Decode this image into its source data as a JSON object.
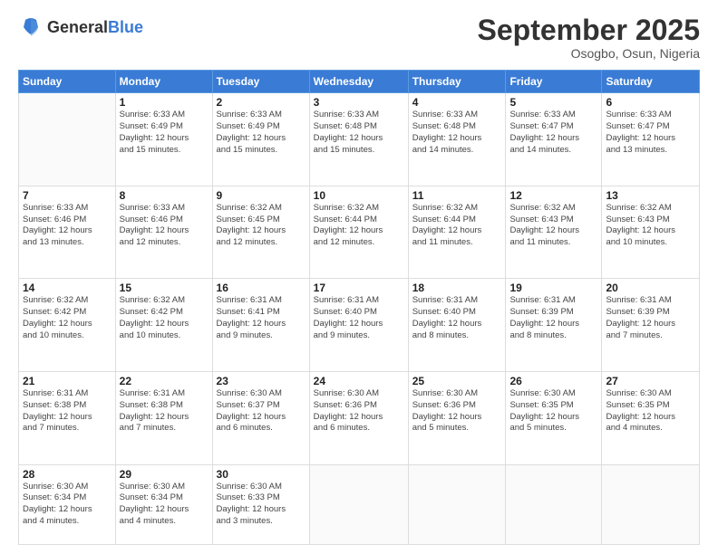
{
  "header": {
    "logo_general": "General",
    "logo_blue": "Blue",
    "month_title": "September 2025",
    "location": "Osogbo, Osun, Nigeria"
  },
  "weekdays": [
    "Sunday",
    "Monday",
    "Tuesday",
    "Wednesday",
    "Thursday",
    "Friday",
    "Saturday"
  ],
  "weeks": [
    [
      {
        "day": "",
        "info": ""
      },
      {
        "day": "1",
        "info": "Sunrise: 6:33 AM\nSunset: 6:49 PM\nDaylight: 12 hours\nand 15 minutes."
      },
      {
        "day": "2",
        "info": "Sunrise: 6:33 AM\nSunset: 6:49 PM\nDaylight: 12 hours\nand 15 minutes."
      },
      {
        "day": "3",
        "info": "Sunrise: 6:33 AM\nSunset: 6:48 PM\nDaylight: 12 hours\nand 15 minutes."
      },
      {
        "day": "4",
        "info": "Sunrise: 6:33 AM\nSunset: 6:48 PM\nDaylight: 12 hours\nand 14 minutes."
      },
      {
        "day": "5",
        "info": "Sunrise: 6:33 AM\nSunset: 6:47 PM\nDaylight: 12 hours\nand 14 minutes."
      },
      {
        "day": "6",
        "info": "Sunrise: 6:33 AM\nSunset: 6:47 PM\nDaylight: 12 hours\nand 13 minutes."
      }
    ],
    [
      {
        "day": "7",
        "info": "Sunrise: 6:33 AM\nSunset: 6:46 PM\nDaylight: 12 hours\nand 13 minutes."
      },
      {
        "day": "8",
        "info": "Sunrise: 6:33 AM\nSunset: 6:46 PM\nDaylight: 12 hours\nand 12 minutes."
      },
      {
        "day": "9",
        "info": "Sunrise: 6:32 AM\nSunset: 6:45 PM\nDaylight: 12 hours\nand 12 minutes."
      },
      {
        "day": "10",
        "info": "Sunrise: 6:32 AM\nSunset: 6:44 PM\nDaylight: 12 hours\nand 12 minutes."
      },
      {
        "day": "11",
        "info": "Sunrise: 6:32 AM\nSunset: 6:44 PM\nDaylight: 12 hours\nand 11 minutes."
      },
      {
        "day": "12",
        "info": "Sunrise: 6:32 AM\nSunset: 6:43 PM\nDaylight: 12 hours\nand 11 minutes."
      },
      {
        "day": "13",
        "info": "Sunrise: 6:32 AM\nSunset: 6:43 PM\nDaylight: 12 hours\nand 10 minutes."
      }
    ],
    [
      {
        "day": "14",
        "info": "Sunrise: 6:32 AM\nSunset: 6:42 PM\nDaylight: 12 hours\nand 10 minutes."
      },
      {
        "day": "15",
        "info": "Sunrise: 6:32 AM\nSunset: 6:42 PM\nDaylight: 12 hours\nand 10 minutes."
      },
      {
        "day": "16",
        "info": "Sunrise: 6:31 AM\nSunset: 6:41 PM\nDaylight: 12 hours\nand 9 minutes."
      },
      {
        "day": "17",
        "info": "Sunrise: 6:31 AM\nSunset: 6:40 PM\nDaylight: 12 hours\nand 9 minutes."
      },
      {
        "day": "18",
        "info": "Sunrise: 6:31 AM\nSunset: 6:40 PM\nDaylight: 12 hours\nand 8 minutes."
      },
      {
        "day": "19",
        "info": "Sunrise: 6:31 AM\nSunset: 6:39 PM\nDaylight: 12 hours\nand 8 minutes."
      },
      {
        "day": "20",
        "info": "Sunrise: 6:31 AM\nSunset: 6:39 PM\nDaylight: 12 hours\nand 7 minutes."
      }
    ],
    [
      {
        "day": "21",
        "info": "Sunrise: 6:31 AM\nSunset: 6:38 PM\nDaylight: 12 hours\nand 7 minutes."
      },
      {
        "day": "22",
        "info": "Sunrise: 6:31 AM\nSunset: 6:38 PM\nDaylight: 12 hours\nand 7 minutes."
      },
      {
        "day": "23",
        "info": "Sunrise: 6:30 AM\nSunset: 6:37 PM\nDaylight: 12 hours\nand 6 minutes."
      },
      {
        "day": "24",
        "info": "Sunrise: 6:30 AM\nSunset: 6:36 PM\nDaylight: 12 hours\nand 6 minutes."
      },
      {
        "day": "25",
        "info": "Sunrise: 6:30 AM\nSunset: 6:36 PM\nDaylight: 12 hours\nand 5 minutes."
      },
      {
        "day": "26",
        "info": "Sunrise: 6:30 AM\nSunset: 6:35 PM\nDaylight: 12 hours\nand 5 minutes."
      },
      {
        "day": "27",
        "info": "Sunrise: 6:30 AM\nSunset: 6:35 PM\nDaylight: 12 hours\nand 4 minutes."
      }
    ],
    [
      {
        "day": "28",
        "info": "Sunrise: 6:30 AM\nSunset: 6:34 PM\nDaylight: 12 hours\nand 4 minutes."
      },
      {
        "day": "29",
        "info": "Sunrise: 6:30 AM\nSunset: 6:34 PM\nDaylight: 12 hours\nand 4 minutes."
      },
      {
        "day": "30",
        "info": "Sunrise: 6:30 AM\nSunset: 6:33 PM\nDaylight: 12 hours\nand 3 minutes."
      },
      {
        "day": "",
        "info": ""
      },
      {
        "day": "",
        "info": ""
      },
      {
        "day": "",
        "info": ""
      },
      {
        "day": "",
        "info": ""
      }
    ]
  ]
}
